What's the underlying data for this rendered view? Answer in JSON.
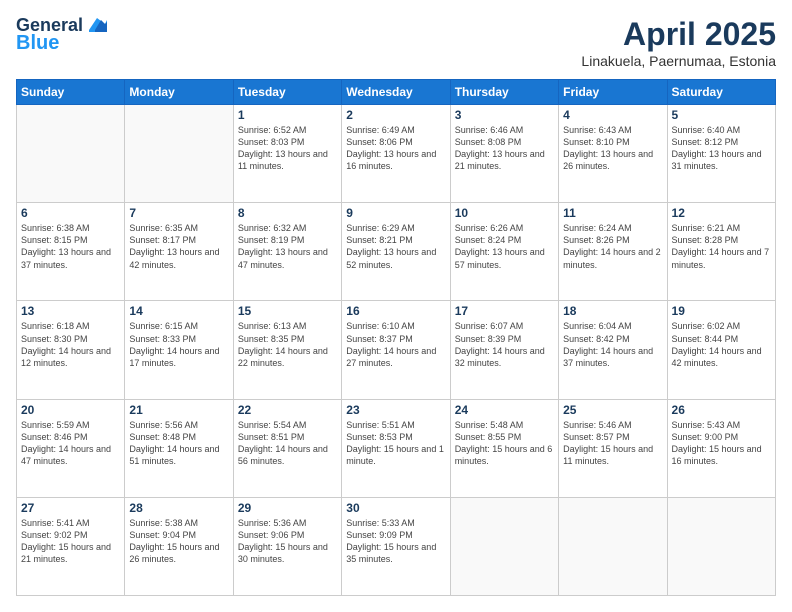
{
  "header": {
    "logo_line1": "General",
    "logo_line2": "Blue",
    "month_title": "April 2025",
    "subtitle": "Linakuela, Paernumaa, Estonia"
  },
  "days_of_week": [
    "Sunday",
    "Monday",
    "Tuesday",
    "Wednesday",
    "Thursday",
    "Friday",
    "Saturday"
  ],
  "weeks": [
    [
      {
        "day": "",
        "info": ""
      },
      {
        "day": "",
        "info": ""
      },
      {
        "day": "1",
        "info": "Sunrise: 6:52 AM\nSunset: 8:03 PM\nDaylight: 13 hours and 11 minutes."
      },
      {
        "day": "2",
        "info": "Sunrise: 6:49 AM\nSunset: 8:06 PM\nDaylight: 13 hours and 16 minutes."
      },
      {
        "day": "3",
        "info": "Sunrise: 6:46 AM\nSunset: 8:08 PM\nDaylight: 13 hours and 21 minutes."
      },
      {
        "day": "4",
        "info": "Sunrise: 6:43 AM\nSunset: 8:10 PM\nDaylight: 13 hours and 26 minutes."
      },
      {
        "day": "5",
        "info": "Sunrise: 6:40 AM\nSunset: 8:12 PM\nDaylight: 13 hours and 31 minutes."
      }
    ],
    [
      {
        "day": "6",
        "info": "Sunrise: 6:38 AM\nSunset: 8:15 PM\nDaylight: 13 hours and 37 minutes."
      },
      {
        "day": "7",
        "info": "Sunrise: 6:35 AM\nSunset: 8:17 PM\nDaylight: 13 hours and 42 minutes."
      },
      {
        "day": "8",
        "info": "Sunrise: 6:32 AM\nSunset: 8:19 PM\nDaylight: 13 hours and 47 minutes."
      },
      {
        "day": "9",
        "info": "Sunrise: 6:29 AM\nSunset: 8:21 PM\nDaylight: 13 hours and 52 minutes."
      },
      {
        "day": "10",
        "info": "Sunrise: 6:26 AM\nSunset: 8:24 PM\nDaylight: 13 hours and 57 minutes."
      },
      {
        "day": "11",
        "info": "Sunrise: 6:24 AM\nSunset: 8:26 PM\nDaylight: 14 hours and 2 minutes."
      },
      {
        "day": "12",
        "info": "Sunrise: 6:21 AM\nSunset: 8:28 PM\nDaylight: 14 hours and 7 minutes."
      }
    ],
    [
      {
        "day": "13",
        "info": "Sunrise: 6:18 AM\nSunset: 8:30 PM\nDaylight: 14 hours and 12 minutes."
      },
      {
        "day": "14",
        "info": "Sunrise: 6:15 AM\nSunset: 8:33 PM\nDaylight: 14 hours and 17 minutes."
      },
      {
        "day": "15",
        "info": "Sunrise: 6:13 AM\nSunset: 8:35 PM\nDaylight: 14 hours and 22 minutes."
      },
      {
        "day": "16",
        "info": "Sunrise: 6:10 AM\nSunset: 8:37 PM\nDaylight: 14 hours and 27 minutes."
      },
      {
        "day": "17",
        "info": "Sunrise: 6:07 AM\nSunset: 8:39 PM\nDaylight: 14 hours and 32 minutes."
      },
      {
        "day": "18",
        "info": "Sunrise: 6:04 AM\nSunset: 8:42 PM\nDaylight: 14 hours and 37 minutes."
      },
      {
        "day": "19",
        "info": "Sunrise: 6:02 AM\nSunset: 8:44 PM\nDaylight: 14 hours and 42 minutes."
      }
    ],
    [
      {
        "day": "20",
        "info": "Sunrise: 5:59 AM\nSunset: 8:46 PM\nDaylight: 14 hours and 47 minutes."
      },
      {
        "day": "21",
        "info": "Sunrise: 5:56 AM\nSunset: 8:48 PM\nDaylight: 14 hours and 51 minutes."
      },
      {
        "day": "22",
        "info": "Sunrise: 5:54 AM\nSunset: 8:51 PM\nDaylight: 14 hours and 56 minutes."
      },
      {
        "day": "23",
        "info": "Sunrise: 5:51 AM\nSunset: 8:53 PM\nDaylight: 15 hours and 1 minute."
      },
      {
        "day": "24",
        "info": "Sunrise: 5:48 AM\nSunset: 8:55 PM\nDaylight: 15 hours and 6 minutes."
      },
      {
        "day": "25",
        "info": "Sunrise: 5:46 AM\nSunset: 8:57 PM\nDaylight: 15 hours and 11 minutes."
      },
      {
        "day": "26",
        "info": "Sunrise: 5:43 AM\nSunset: 9:00 PM\nDaylight: 15 hours and 16 minutes."
      }
    ],
    [
      {
        "day": "27",
        "info": "Sunrise: 5:41 AM\nSunset: 9:02 PM\nDaylight: 15 hours and 21 minutes."
      },
      {
        "day": "28",
        "info": "Sunrise: 5:38 AM\nSunset: 9:04 PM\nDaylight: 15 hours and 26 minutes."
      },
      {
        "day": "29",
        "info": "Sunrise: 5:36 AM\nSunset: 9:06 PM\nDaylight: 15 hours and 30 minutes."
      },
      {
        "day": "30",
        "info": "Sunrise: 5:33 AM\nSunset: 9:09 PM\nDaylight: 15 hours and 35 minutes."
      },
      {
        "day": "",
        "info": ""
      },
      {
        "day": "",
        "info": ""
      },
      {
        "day": "",
        "info": ""
      }
    ]
  ]
}
